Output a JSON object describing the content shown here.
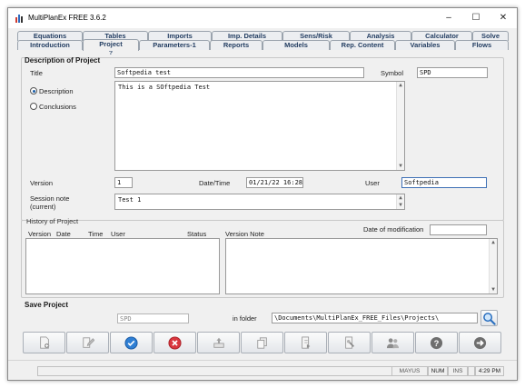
{
  "window": {
    "title": "MultiPlanEx FREE  3.6.2",
    "minimize": "–",
    "maximize": "☐",
    "close": "✕"
  },
  "tabs": {
    "row1": [
      "Equations",
      "Tables",
      "Imports",
      "Imp. Details",
      "Sens/Risk",
      "Analysis",
      "Calculator",
      "Solve"
    ],
    "row2": [
      "Introduction",
      "Project",
      "Parameters-1",
      "Reports",
      "Models",
      "Rep. Content",
      "Variables",
      "Flows"
    ],
    "project_sub": "?"
  },
  "description": {
    "section_title": "Description of Project",
    "title_label": "Title",
    "title_value": "Softpedia test",
    "symbol_label": "Symbol",
    "symbol_value": "SPD",
    "radio_description": "Description",
    "radio_conclusions": "Conclusions",
    "body_text": "This is a SOftpedia Test",
    "version_label": "Version",
    "version_value": "1",
    "datetime_label": "Date/Time",
    "datetime_value": "01/21/22  16:28",
    "user_label": "User",
    "user_value": "Softpedia",
    "session_note_label_1": "Session note",
    "session_note_label_2": "(current)",
    "session_note_value": "Test 1"
  },
  "history": {
    "section_title": "History of Project",
    "columns": [
      "Version",
      "Date",
      "Time",
      "User",
      "Status"
    ],
    "version_note_label": "Version Note",
    "date_mod_label": "Date of modification",
    "date_mod_value": ""
  },
  "save": {
    "section_title": "Save Project",
    "symbol_value": "SPD",
    "in_folder_label": "in  folder",
    "folder_value": "\\Documents\\MultiPlanEx_FREE_Files\\Projects\\"
  },
  "toolbar": {
    "icons": [
      "new-document-icon",
      "edit-icon",
      "confirm-icon",
      "delete-icon",
      "upload-icon",
      "copy-icon",
      "export-icon",
      "tools-icon",
      "users-icon",
      "help-icon",
      "exit-icon"
    ]
  },
  "statusbar": {
    "mayus": "MAYUS",
    "num": "NUM",
    "ins": "INS",
    "time": "4:29 PM"
  }
}
